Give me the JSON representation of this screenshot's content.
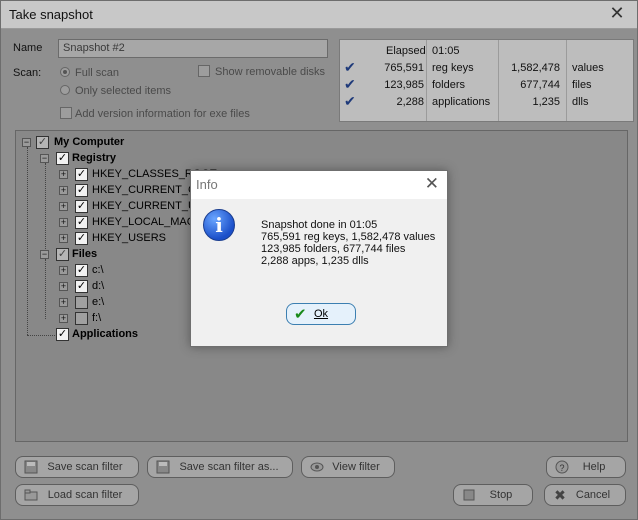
{
  "window": {
    "title": "Take snapshot",
    "close": "✕"
  },
  "form": {
    "name_label": "Name",
    "name_value": "Snapshot #2",
    "scan_label": "Scan:",
    "full_scan": "Full scan",
    "only_selected": "Only selected items",
    "show_removable": "Show removable disks",
    "add_version": "Add version information for exe files"
  },
  "stats": {
    "elapsed_label": "Elapsed",
    "elapsed_value": "01:05",
    "rows": [
      {
        "count": "765,591",
        "type": "reg keys",
        "count2": "1,582,478",
        "type2": "values"
      },
      {
        "count": "123,985",
        "type": "folders",
        "count2": "677,744",
        "type2": "files"
      },
      {
        "count": "2,288",
        "type": "applications",
        "count2": "1,235",
        "type2": "dlls"
      }
    ]
  },
  "tree": {
    "root": "My Computer",
    "registry": "Registry",
    "keys": [
      "HKEY_CLASSES_ROOT",
      "HKEY_CURRENT_CO",
      "HKEY_CURRENT_US",
      "HKEY_LOCAL_MACH",
      "HKEY_USERS"
    ],
    "files": "Files",
    "drives": [
      "c:\\",
      "d:\\",
      "e:\\",
      "f:\\"
    ],
    "applications": "Applications"
  },
  "buttons": {
    "save_filter": "Save scan filter",
    "save_filter_as": "Save scan filter as...",
    "view_filter": "View filter",
    "help": "Help",
    "load_filter": "Load scan filter",
    "stop": "Stop",
    "cancel": "Cancel"
  },
  "dialog": {
    "title": "Info",
    "close": "✕",
    "lines": [
      "Snapshot done in 01:05",
      "765,591 reg keys, 1,582,478 values",
      "123,985 folders, 677,744 files",
      "2,288 apps, 1,235 dlls"
    ],
    "ok": "Ok",
    "icon_glyph": "i"
  }
}
